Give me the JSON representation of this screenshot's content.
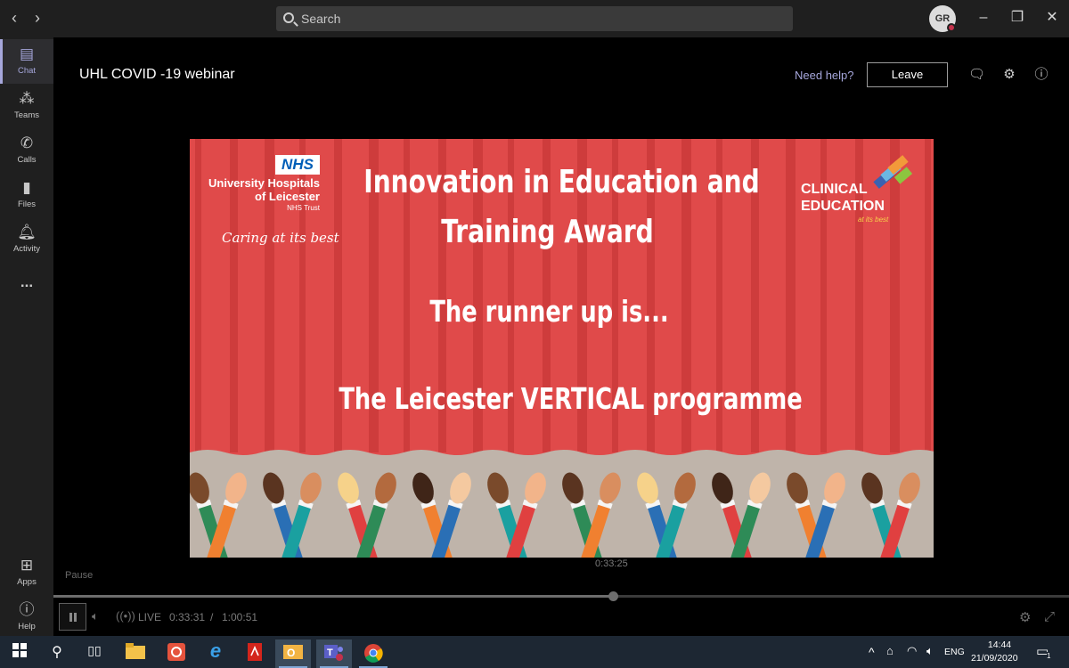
{
  "titlebar": {
    "search_placeholder": "Search",
    "avatar_initials": "GR"
  },
  "appbar": {
    "items": [
      {
        "label": "Chat",
        "icon": "chat-icon"
      },
      {
        "label": "Teams",
        "icon": "teams-icon"
      },
      {
        "label": "Calls",
        "icon": "phone-icon"
      },
      {
        "label": "Files",
        "icon": "file-icon"
      },
      {
        "label": "Activity",
        "icon": "bell-icon"
      },
      {
        "label": "Apps",
        "icon": "apps-icon"
      },
      {
        "label": "Help",
        "icon": "help-icon"
      }
    ],
    "more": "..."
  },
  "meeting": {
    "title": "UHL COVID -19 webinar",
    "need_help": "Need help?",
    "leave_label": "Leave"
  },
  "slide": {
    "nhs": "NHS",
    "org_line1": "University Hospitals",
    "org_line2": "of Leicester",
    "org_line3": "NHS Trust",
    "tagline": "Caring at its best",
    "ce_line1": "CLINICAL",
    "ce_line2": "EDUCATION",
    "ce_tagline": "at its best",
    "headline_line1": "Innovation in Education and",
    "headline_line2": "Training Award",
    "subhead": "The runner up is...",
    "winner": "The Leicester VERTICAL programme"
  },
  "playback": {
    "hover_time": "0:33:25",
    "pause_label": "Pause",
    "live_label": "LIVE",
    "current_time": "0:33:31",
    "separator": "/",
    "duration": "1:00:51",
    "progress": 0.548
  },
  "taskbar": {
    "language": "ENG",
    "time": "14:44",
    "date": "21/09/2020",
    "notification_count": "1"
  },
  "colors": {
    "accent": "#a6a7dc",
    "curtain": "#e04a4a",
    "nhs_blue": "#005eb8",
    "presence_busy": "#c4314b"
  }
}
